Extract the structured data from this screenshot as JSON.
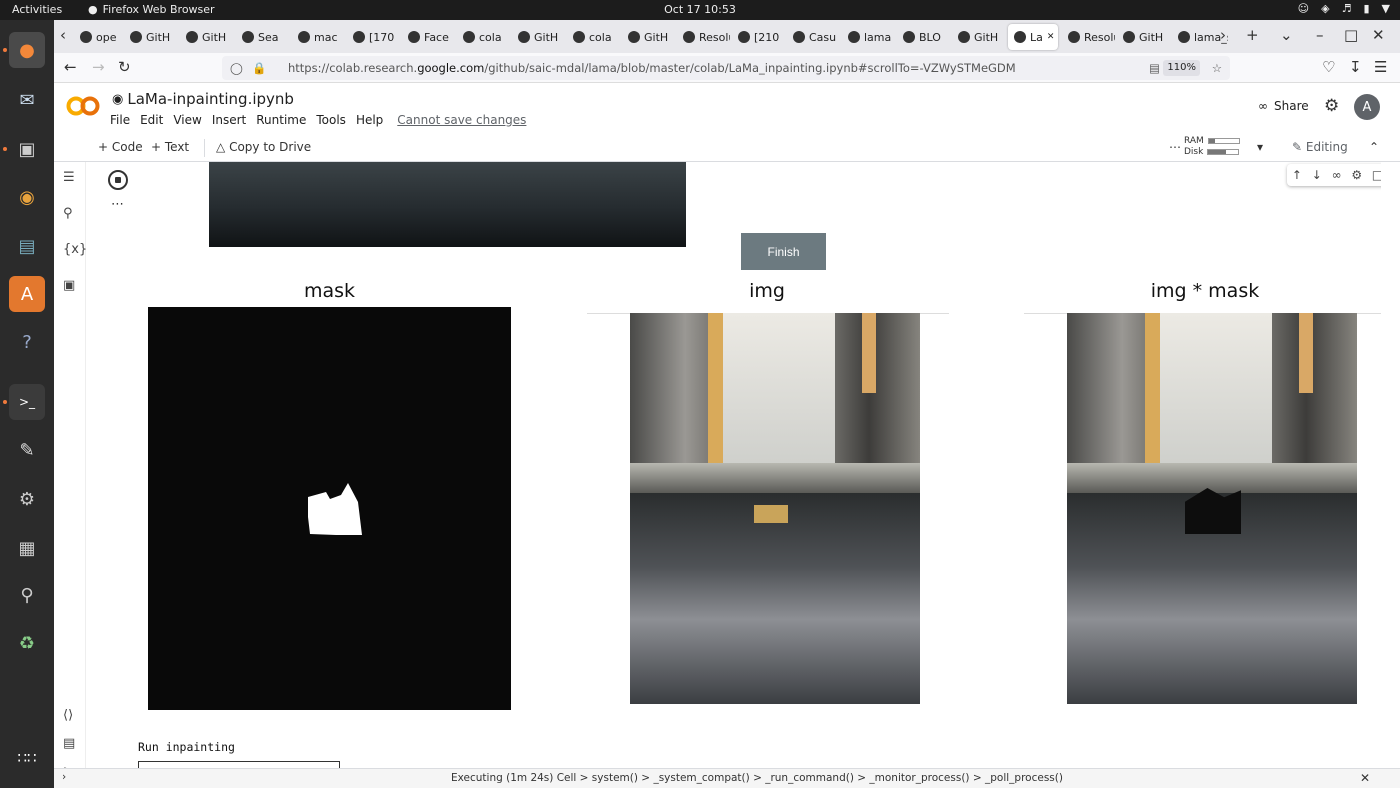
{
  "topbar": {
    "activities": "Activities",
    "app": "Firefox Web Browser",
    "clock": "Oct 17  10:53"
  },
  "dock": {
    "items": [
      "firefox-icon",
      "thunderbird-icon",
      "files-icon",
      "rhythmbox-icon",
      "writer-icon",
      "software-icon",
      "help-icon",
      "terminal-icon",
      "text-editor-icon",
      "settings-icon",
      "calc-icon",
      "search-icon",
      "trash-icon",
      "apps-grid-icon"
    ]
  },
  "tabs": [
    {
      "label": "ope"
    },
    {
      "label": "GitH"
    },
    {
      "label": "GitH"
    },
    {
      "label": "Sea"
    },
    {
      "label": "mac"
    },
    {
      "label": "[170"
    },
    {
      "label": "Face"
    },
    {
      "label": "cola"
    },
    {
      "label": "GitH"
    },
    {
      "label": "cola"
    },
    {
      "label": "GitH"
    },
    {
      "label": "Resolu"
    },
    {
      "label": "[210"
    },
    {
      "label": "Casu"
    },
    {
      "label": "lama"
    },
    {
      "label": "BLO"
    },
    {
      "label": "GitH"
    },
    {
      "label": "La"
    },
    {
      "label": "Resolu"
    },
    {
      "label": "GitH"
    },
    {
      "label": "lama_su"
    }
  ],
  "navbar": {
    "url_prefix": "https://colab.research.",
    "url_domain": "google.com",
    "url_suffix": "/github/saic-mdal/lama/blob/master/colab/LaMa_inpainting.ipynb#scrollTo=-VZWySTMeGDM",
    "zoom": "110%"
  },
  "colab": {
    "title": "LaMa-inpainting.ipynb",
    "menu": [
      "File",
      "Edit",
      "View",
      "Insert",
      "Runtime",
      "Tools",
      "Help"
    ],
    "unsaved": "Cannot save changes",
    "share": "Share",
    "avatar": "A",
    "toolbar": {
      "code": "+ Code",
      "text": "+ Text",
      "copy": "Copy to Drive",
      "ram": "RAM",
      "disk": "Disk",
      "ram_level": 0.2,
      "disk_level": 0.6,
      "editing": "Editing"
    }
  },
  "output": {
    "finish": "Finish",
    "panel_titles": [
      "mask",
      "img",
      "img * mask"
    ],
    "run_label": "Run inpainting",
    "progress": 0
  },
  "statusbar": {
    "text": "Executing (1m 24s)  Cell > system() > _system_compat() > _run_command() > _monitor_process() > _poll_process()"
  }
}
